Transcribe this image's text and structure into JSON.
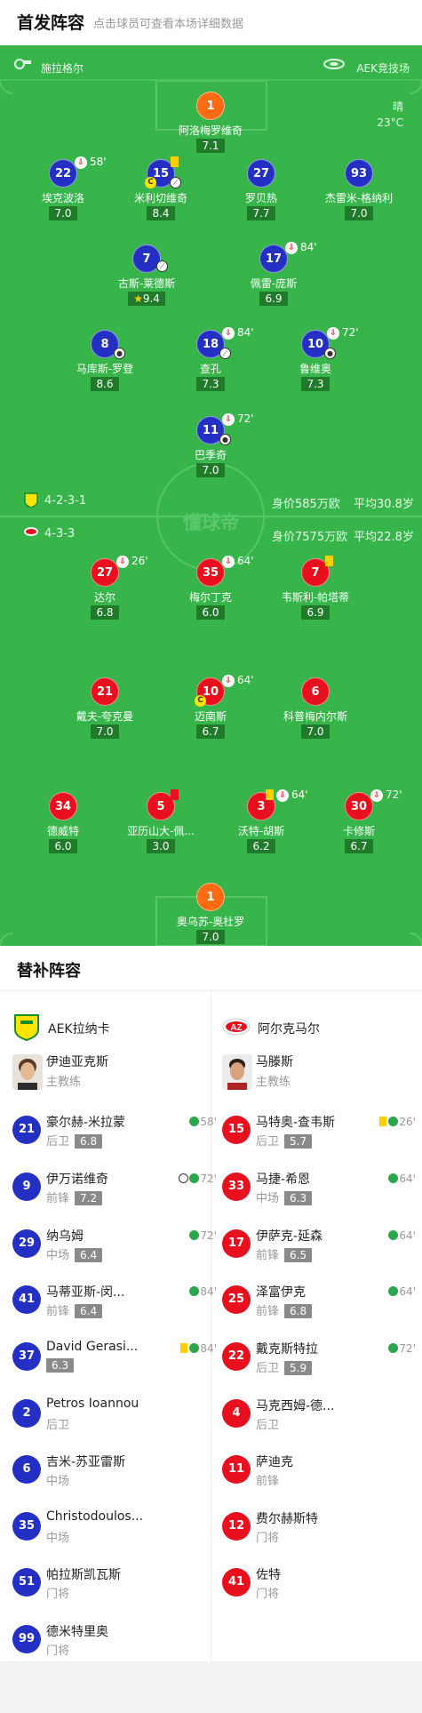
{
  "header": {
    "title": "首发阵容",
    "subtitle": "点击球员可查看本场详细数据"
  },
  "venue": {
    "home": "施拉格尔",
    "stadium": "AEK竞技场"
  },
  "weather": {
    "condition": "晴",
    "temp": "23°C"
  },
  "home_formation": {
    "formation": "4-2-3-1",
    "value": "身价585万欧",
    "age": "平均30.8岁"
  },
  "away_formation": {
    "formation": "4-3-3",
    "value": "身价7575万欧",
    "age": "平均22.8岁"
  },
  "watermark": "懂球帝",
  "home_players": [
    {
      "num": "1",
      "name": "阿洛梅罗维奇",
      "rating": "7.1"
    },
    {
      "num": "22",
      "name": "埃克波洛",
      "rating": "7.0",
      "min": "58'"
    },
    {
      "num": "15",
      "name": "米利切维奇",
      "rating": "8.4"
    },
    {
      "num": "27",
      "name": "罗贝热",
      "rating": "7.7"
    },
    {
      "num": "93",
      "name": "杰雷米-格纳利",
      "rating": "7.0"
    },
    {
      "num": "7",
      "name": "古斯-莱德斯",
      "rating": "9.4"
    },
    {
      "num": "17",
      "name": "佩雷-庞斯",
      "rating": "6.9",
      "min": "84'"
    },
    {
      "num": "8",
      "name": "马库斯-罗登",
      "rating": "8.6"
    },
    {
      "num": "18",
      "name": "查孔",
      "rating": "7.3",
      "min": "84'"
    },
    {
      "num": "10",
      "name": "鲁维奥",
      "rating": "7.3",
      "min": "72'"
    },
    {
      "num": "11",
      "name": "巴季奇",
      "rating": "7.0",
      "min": "72'"
    }
  ],
  "away_players": [
    {
      "num": "27",
      "name": "达尔",
      "rating": "6.8",
      "min": "26'"
    },
    {
      "num": "35",
      "name": "梅尔丁克",
      "rating": "6.0",
      "min": "64'"
    },
    {
      "num": "7",
      "name": "韦斯利-帕塔蒂",
      "rating": "6.9"
    },
    {
      "num": "21",
      "name": "戴夫-夸克曼",
      "rating": "7.0"
    },
    {
      "num": "10",
      "name": "迈南斯",
      "rating": "6.7",
      "min": "64'"
    },
    {
      "num": "6",
      "name": "科普梅内尔斯",
      "rating": "7.0"
    },
    {
      "num": "34",
      "name": "德威特",
      "rating": "6.0"
    },
    {
      "num": "5",
      "name": "亚历山大-佩...",
      "rating": "3.0"
    },
    {
      "num": "3",
      "name": "沃特-胡斯",
      "rating": "6.2",
      "min": "64'"
    },
    {
      "num": "30",
      "name": "卡修斯",
      "rating": "6.7",
      "min": "72'"
    },
    {
      "num": "1",
      "name": "奥乌苏-奥杜罗",
      "rating": "7.0"
    }
  ],
  "subs": {
    "title": "替补阵容",
    "home_team": "AEK拉纳卡",
    "away_team": "阿尔克马尔",
    "home_coach": {
      "name": "伊迪亚克斯",
      "role": "主教练"
    },
    "away_coach": {
      "name": "马滕斯",
      "role": "主教练"
    },
    "home": [
      {
        "num": "21",
        "name": "豪尔赫-米拉蒙",
        "pos": "后卫",
        "rating": "6.8",
        "ev": "58'"
      },
      {
        "num": "9",
        "name": "伊万诺维奇",
        "pos": "前锋",
        "rating": "7.2",
        "ev": "72'"
      },
      {
        "num": "29",
        "name": "纳乌姆",
        "pos": "中场",
        "rating": "6.4",
        "ev": "72'"
      },
      {
        "num": "41",
        "name": "马蒂亚斯-闵...",
        "pos": "前锋",
        "rating": "6.4",
        "ev": "84'"
      },
      {
        "num": "37",
        "name": "David Gerasi...",
        "pos": "",
        "rating": "6.3",
        "ev": "84'"
      },
      {
        "num": "2",
        "name": "Petros Ioannou",
        "pos": "后卫"
      },
      {
        "num": "6",
        "name": "吉米-苏亚雷斯",
        "pos": "中场"
      },
      {
        "num": "35",
        "name": "Christodoulos...",
        "pos": "中场"
      },
      {
        "num": "51",
        "name": "帕拉斯凯瓦斯",
        "pos": "门将"
      },
      {
        "num": "99",
        "name": "德米特里奥",
        "pos": "门将"
      }
    ],
    "away": [
      {
        "num": "15",
        "name": "马特奥-查韦斯",
        "pos": "后卫",
        "rating": "5.7",
        "ev": "26'"
      },
      {
        "num": "33",
        "name": "马捷-希恩",
        "pos": "中场",
        "rating": "6.3",
        "ev": "64'"
      },
      {
        "num": "17",
        "name": "伊萨克-延森",
        "pos": "前锋",
        "rating": "6.5",
        "ev": "64'"
      },
      {
        "num": "25",
        "name": "泽富伊克",
        "pos": "前锋",
        "rating": "6.8",
        "ev": "64'"
      },
      {
        "num": "22",
        "name": "戴克斯特拉",
        "pos": "后卫",
        "rating": "5.9",
        "ev": "72'"
      },
      {
        "num": "4",
        "name": "马克西姆-德...",
        "pos": "后卫"
      },
      {
        "num": "11",
        "name": "萨迪克",
        "pos": "前锋"
      },
      {
        "num": "12",
        "name": "费尔赫斯特",
        "pos": "门将"
      },
      {
        "num": "41",
        "name": "佐特",
        "pos": "门将"
      }
    ]
  },
  "colors": {
    "pitch": "#37b54a",
    "home": "#2430c4",
    "away": "#e8101e",
    "keeper": "#ff6b12"
  }
}
